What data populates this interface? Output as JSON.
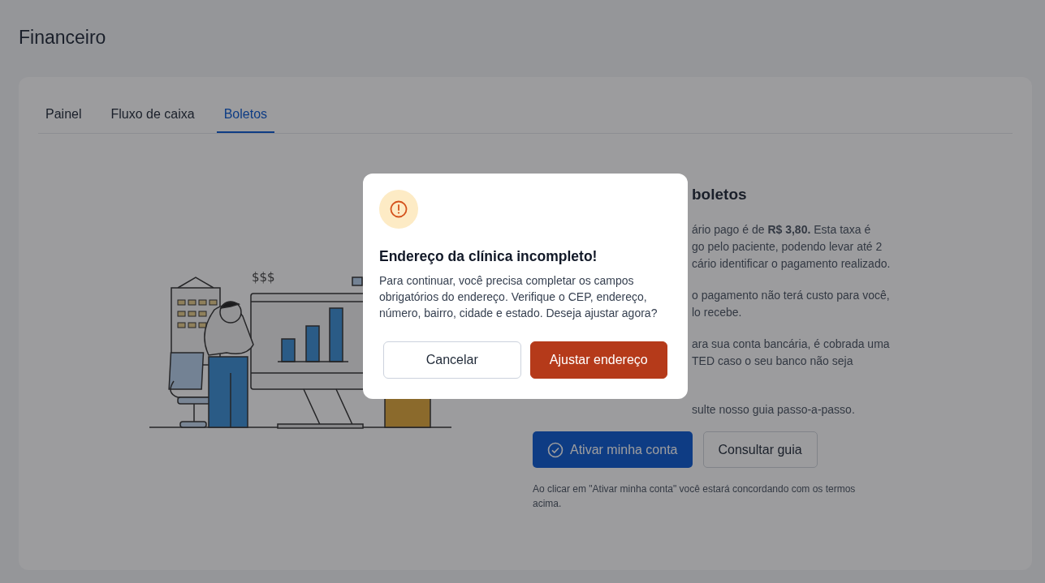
{
  "page": {
    "title": "Financeiro"
  },
  "tabs": [
    {
      "label": "Painel",
      "selected": false
    },
    {
      "label": "Fluxo de caixa",
      "selected": false
    },
    {
      "label": "Boletos",
      "selected": true
    }
  ],
  "illustration": {
    "caption": "$$$"
  },
  "info": {
    "title": "boletos",
    "paragraphs": [
      [
        "ário pago é de **R$ 3,80.** Esta taxa é",
        "go pelo paciente, podendo levar até 2",
        "cário identificar o pagamento realizado."
      ],
      [
        "o pagamento não terá custo para você,",
        "lo recebe."
      ],
      [
        "ara sua conta bancária, é cobrada uma",
        "TED caso o seu banco não seja"
      ],
      [
        "sulte nosso guia passo-a-passo."
      ]
    ],
    "primary_action": {
      "label": "Ativar minha conta"
    },
    "secondary_action": {
      "label": "Consultar guia"
    },
    "terms_note": "Ao clicar em \"Ativar minha conta\" você estará concordando com os termos acima."
  },
  "dialog": {
    "title": "Endereço da clínica incompleto!",
    "message": "Para continuar, você precisa completar os campos obrigatórios do endereço. Verifique o CEP, endereço, número, bairro, cidade e estado. Deseja ajustar agora?",
    "buttons": [
      {
        "label": "Cancelar",
        "kind": "secondary"
      },
      {
        "label": "Ajustar endereço",
        "kind": "danger"
      }
    ]
  }
}
